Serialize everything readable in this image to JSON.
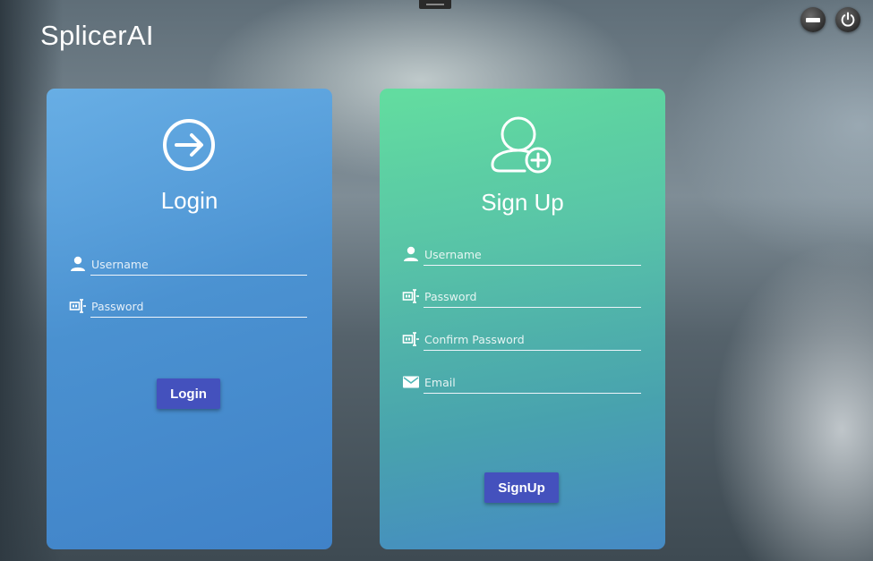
{
  "app": {
    "title": "SplicerAI"
  },
  "window_controls": {
    "minimize_icon": "minimize-icon",
    "power_icon": "power-icon"
  },
  "login": {
    "heading": "Login",
    "icon": "sign-in-icon",
    "username": {
      "placeholder": "Username",
      "value": "",
      "icon": "user-icon"
    },
    "password": {
      "placeholder": "Password",
      "value": "",
      "icon": "password-icon"
    },
    "button_label": "Login",
    "accent": "#4451bd"
  },
  "signup": {
    "heading": "Sign Up",
    "icon": "add-user-icon",
    "username": {
      "placeholder": "Username",
      "value": "",
      "icon": "user-icon"
    },
    "password": {
      "placeholder": "Password",
      "value": "",
      "icon": "password-icon"
    },
    "confirm_password": {
      "placeholder": "Confirm Password",
      "value": "",
      "icon": "password-icon"
    },
    "email": {
      "placeholder": "Email",
      "value": "",
      "icon": "email-icon"
    },
    "button_label": "SignUp",
    "accent": "#4451bd"
  }
}
